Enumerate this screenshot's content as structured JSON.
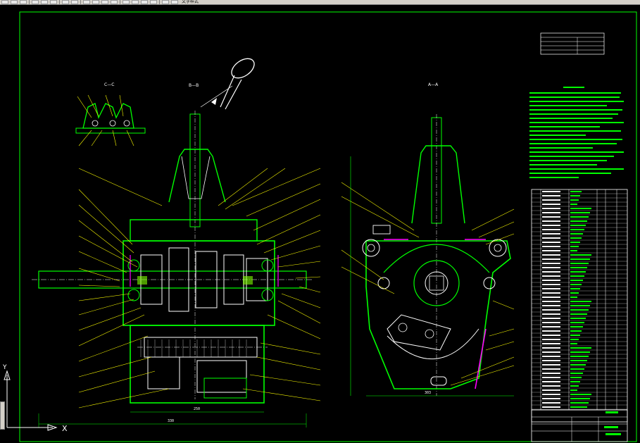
{
  "app": {
    "toolbar_label": "文字样式"
  },
  "drawing": {
    "view_cc": "C—C",
    "view_bb": "B—B",
    "view_aa": "A—A",
    "table_title": "",
    "tech_req_title": "",
    "part_table_title": "",
    "dim_bottom_left": "330",
    "dim_bottom_mid": "250",
    "dim_bottom_right": "303"
  },
  "ucs": {
    "x_label": "X",
    "y_label": "Y"
  },
  "colors": {
    "frame": "#00ff00",
    "leader": "#ffff00",
    "body": "#00ff00",
    "detail": "#ffffff",
    "accent": "#ff00ff",
    "dim": "#00ff00"
  }
}
